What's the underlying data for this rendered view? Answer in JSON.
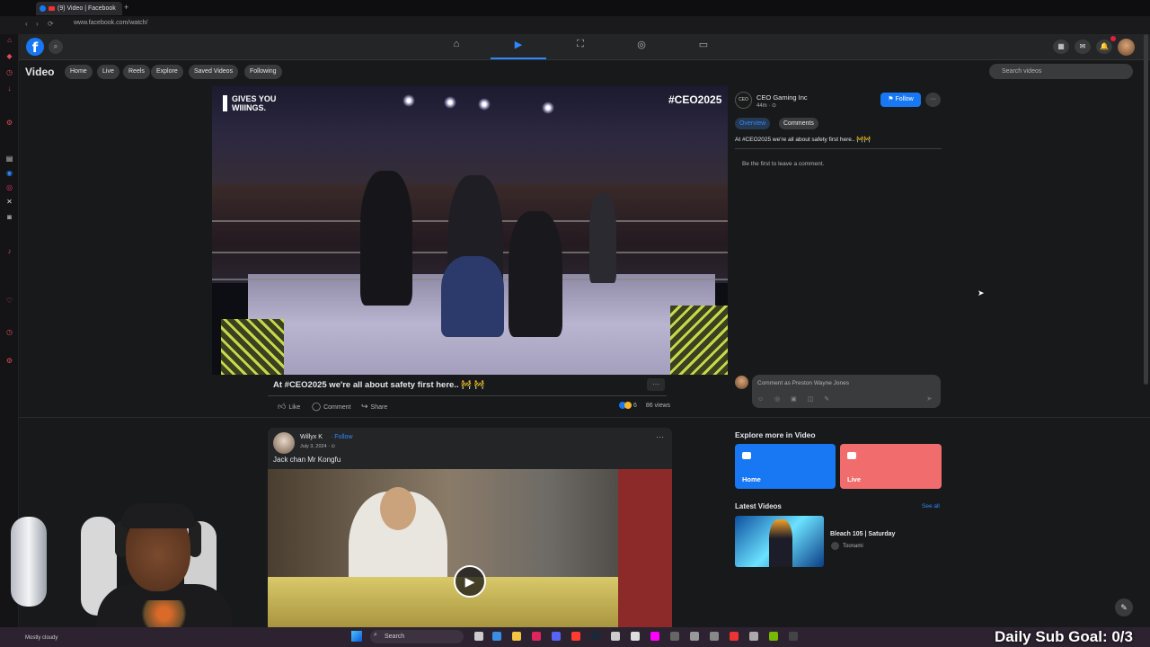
{
  "browser": {
    "tab_title": "(9) Video | Facebook",
    "new_tab": "+",
    "url": "www.facebook.com/watch/",
    "back": "‹",
    "forward": "›",
    "reload": "⟳"
  },
  "fb_header": {
    "logo": "f",
    "nav_items": [
      {
        "name": "home",
        "icon": "⌂"
      },
      {
        "name": "video",
        "icon": "▶"
      },
      {
        "name": "marketplace",
        "icon": "⛶"
      },
      {
        "name": "groups",
        "icon": "◎"
      },
      {
        "name": "gaming",
        "icon": "▭"
      }
    ],
    "right_icons": [
      "▦",
      "✉",
      "🔔"
    ]
  },
  "video_nav": {
    "title": "Video",
    "chips": [
      "Home",
      "Live",
      "Reels",
      "Explore",
      "Saved Videos",
      "Following"
    ],
    "search_placeholder": "Search videos"
  },
  "main_video": {
    "overlay_logo": "GIVES YOU WIIINGS.",
    "overlay_hashtag": "#CEO2025",
    "caption": "At #CEO2025 we're all about safety first here.. 🚧 🚧",
    "more": "···",
    "actions": {
      "like": "Like",
      "comment": "Comment",
      "share": "Share"
    },
    "reaction_count": "6",
    "views": "86 views"
  },
  "channel": {
    "avatar_text": "CEO",
    "name": "CEO Gaming Inc",
    "time": "44m · ⊙",
    "follow": "Follow",
    "more": "···",
    "tabs": {
      "overview": "Overview",
      "comments": "Comments"
    },
    "post_text": "At #CEO2025 we're all about safety first here.. 🚧🚧",
    "empty_comments": "Be the first to leave a comment.",
    "comment_placeholder": "Comment as Preston Wayne Jones",
    "comment_tools": "☺ ◎ ▣ ◫ ✎",
    "send": "➤"
  },
  "post2": {
    "author": "Willyx K",
    "follow": "· Follow",
    "date": "July 3, 2024 · ⊙",
    "more": "···",
    "text": "Jack chan Mr Kongfu",
    "play": "▶"
  },
  "explore": {
    "title": "Explore more in Video",
    "cards": [
      {
        "label": "Home"
      },
      {
        "label": "Live"
      }
    ],
    "latest_title": "Latest Videos",
    "see_all": "See all",
    "latest_item": {
      "title": "Bleach 105 | Saturday",
      "source": "Toonami"
    }
  },
  "taskbar": {
    "search": "Search",
    "weather": "Mostly cloudy"
  },
  "overlay": {
    "sub_goal": "Daily Sub Goal: 0/3"
  },
  "colors": {
    "fb_blue": "#1877f2",
    "bg": "#18191a",
    "surface": "#242526",
    "live_card": "#f16d6d"
  }
}
